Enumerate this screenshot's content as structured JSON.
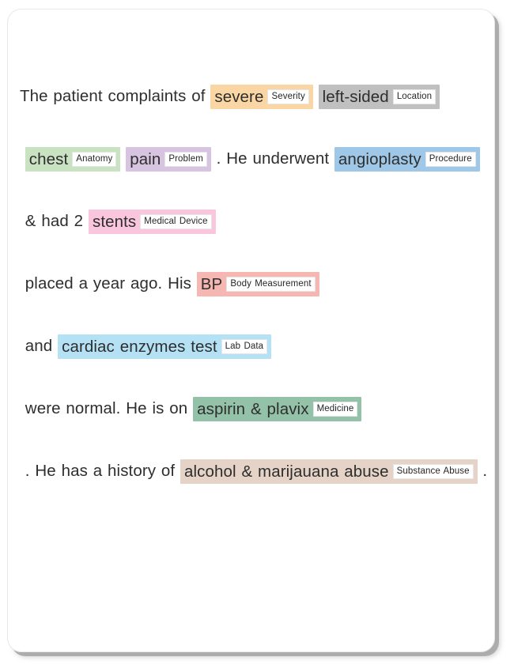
{
  "card": {
    "background": "#ffffff",
    "shadow_color": "#aaaaaa"
  },
  "document": {
    "full_text": "The patient complaints of severe left-sided chest pain . He underwent angioplasty & had 2 stents placed a year ago. His BP and cardiac enzymes test were normal. He is on aspirin & plavix . He has a history of alcohol & marijauana abuse .",
    "tokens": [
      {
        "kind": "text",
        "text": "The patient complaints of "
      },
      {
        "kind": "entity",
        "text": "severe",
        "label": "Severity",
        "color": "#fad6a5"
      },
      {
        "kind": "text",
        "text": " "
      },
      {
        "kind": "entity",
        "text": "left-sided",
        "label": "Location",
        "color": "#c0c0c0"
      },
      {
        "kind": "text",
        "text": " "
      },
      {
        "kind": "entity",
        "text": "chest",
        "label": "Anatomy",
        "color": "#c9e2c1"
      },
      {
        "kind": "text",
        "text": " "
      },
      {
        "kind": "entity",
        "text": "pain",
        "label": "Problem",
        "color": "#d7c4e0"
      },
      {
        "kind": "text",
        "text": " . He underwent "
      },
      {
        "kind": "entity",
        "text": "angioplasty",
        "label": "Procedure",
        "color": "#9fc8e8"
      },
      {
        "kind": "text",
        "text": " & had 2 "
      },
      {
        "kind": "entity",
        "text": "stents",
        "label": "Medical Device",
        "color": "#fac6dd"
      },
      {
        "kind": "text",
        "text": " placed a year ago. His "
      },
      {
        "kind": "entity",
        "text": "BP",
        "label": "Body Measurement",
        "color": "#f6b6b2"
      },
      {
        "kind": "text",
        "text": " and "
      },
      {
        "kind": "entity",
        "text": "cardiac enzymes test",
        "label": "Lab Data",
        "color": "#b5e1f5"
      },
      {
        "kind": "text",
        "text": " were normal. "
      },
      {
        "kind": "text",
        "text": "He is on "
      },
      {
        "kind": "entity",
        "text": "aspirin & plavix",
        "label": "Medicine",
        "color": "#93c2a8"
      },
      {
        "kind": "text",
        "text": " . He has a history of "
      },
      {
        "kind": "entity",
        "text": "alcohol & marijauana abuse",
        "label": "Substance Abuse",
        "color": "#e4d3c6"
      },
      {
        "kind": "text",
        "text": " ."
      }
    ],
    "entities": [
      {
        "text": "severe",
        "label": "Severity",
        "color": "#fad6a5"
      },
      {
        "text": "left-sided",
        "label": "Location",
        "color": "#c0c0c0"
      },
      {
        "text": "chest",
        "label": "Anatomy",
        "color": "#c9e2c1"
      },
      {
        "text": "pain",
        "label": "Problem",
        "color": "#d7c4e0"
      },
      {
        "text": "angioplasty",
        "label": "Procedure",
        "color": "#9fc8e8"
      },
      {
        "text": "stents",
        "label": "Medical Device",
        "color": "#fac6dd"
      },
      {
        "text": "BP",
        "label": "Body Measurement",
        "color": "#f6b6b2"
      },
      {
        "text": "cardiac enzymes test",
        "label": "Lab Data",
        "color": "#b5e1f5"
      },
      {
        "text": "aspirin & plavix",
        "label": "Medicine",
        "color": "#93c2a8"
      },
      {
        "text": "alcohol & marijauana abuse",
        "label": "Substance Abuse",
        "color": "#e4d3c6"
      }
    ]
  }
}
